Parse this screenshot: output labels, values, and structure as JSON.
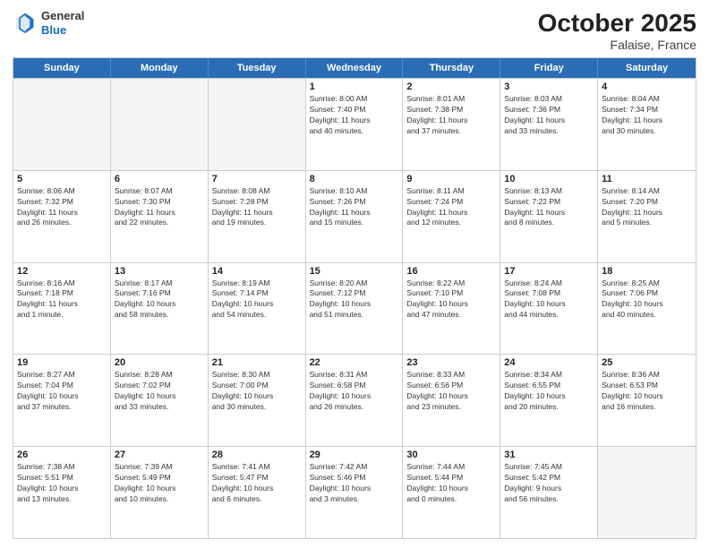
{
  "header": {
    "logo_general": "General",
    "logo_blue": "Blue",
    "month": "October 2025",
    "location": "Falaise, France"
  },
  "days_of_week": [
    "Sunday",
    "Monday",
    "Tuesday",
    "Wednesday",
    "Thursday",
    "Friday",
    "Saturday"
  ],
  "weeks": [
    [
      {
        "day": "",
        "lines": []
      },
      {
        "day": "",
        "lines": []
      },
      {
        "day": "",
        "lines": []
      },
      {
        "day": "1",
        "lines": [
          "Sunrise: 8:00 AM",
          "Sunset: 7:40 PM",
          "Daylight: 11 hours",
          "and 40 minutes."
        ]
      },
      {
        "day": "2",
        "lines": [
          "Sunrise: 8:01 AM",
          "Sunset: 7:38 PM",
          "Daylight: 11 hours",
          "and 37 minutes."
        ]
      },
      {
        "day": "3",
        "lines": [
          "Sunrise: 8:03 AM",
          "Sunset: 7:36 PM",
          "Daylight: 11 hours",
          "and 33 minutes."
        ]
      },
      {
        "day": "4",
        "lines": [
          "Sunrise: 8:04 AM",
          "Sunset: 7:34 PM",
          "Daylight: 11 hours",
          "and 30 minutes."
        ]
      }
    ],
    [
      {
        "day": "5",
        "lines": [
          "Sunrise: 8:06 AM",
          "Sunset: 7:32 PM",
          "Daylight: 11 hours",
          "and 26 minutes."
        ]
      },
      {
        "day": "6",
        "lines": [
          "Sunrise: 8:07 AM",
          "Sunset: 7:30 PM",
          "Daylight: 11 hours",
          "and 22 minutes."
        ]
      },
      {
        "day": "7",
        "lines": [
          "Sunrise: 8:08 AM",
          "Sunset: 7:28 PM",
          "Daylight: 11 hours",
          "and 19 minutes."
        ]
      },
      {
        "day": "8",
        "lines": [
          "Sunrise: 8:10 AM",
          "Sunset: 7:26 PM",
          "Daylight: 11 hours",
          "and 15 minutes."
        ]
      },
      {
        "day": "9",
        "lines": [
          "Sunrise: 8:11 AM",
          "Sunset: 7:24 PM",
          "Daylight: 11 hours",
          "and 12 minutes."
        ]
      },
      {
        "day": "10",
        "lines": [
          "Sunrise: 8:13 AM",
          "Sunset: 7:22 PM",
          "Daylight: 11 hours",
          "and 8 minutes."
        ]
      },
      {
        "day": "11",
        "lines": [
          "Sunrise: 8:14 AM",
          "Sunset: 7:20 PM",
          "Daylight: 11 hours",
          "and 5 minutes."
        ]
      }
    ],
    [
      {
        "day": "12",
        "lines": [
          "Sunrise: 8:16 AM",
          "Sunset: 7:18 PM",
          "Daylight: 11 hours",
          "and 1 minute."
        ]
      },
      {
        "day": "13",
        "lines": [
          "Sunrise: 8:17 AM",
          "Sunset: 7:16 PM",
          "Daylight: 10 hours",
          "and 58 minutes."
        ]
      },
      {
        "day": "14",
        "lines": [
          "Sunrise: 8:19 AM",
          "Sunset: 7:14 PM",
          "Daylight: 10 hours",
          "and 54 minutes."
        ]
      },
      {
        "day": "15",
        "lines": [
          "Sunrise: 8:20 AM",
          "Sunset: 7:12 PM",
          "Daylight: 10 hours",
          "and 51 minutes."
        ]
      },
      {
        "day": "16",
        "lines": [
          "Sunrise: 8:22 AM",
          "Sunset: 7:10 PM",
          "Daylight: 10 hours",
          "and 47 minutes."
        ]
      },
      {
        "day": "17",
        "lines": [
          "Sunrise: 8:24 AM",
          "Sunset: 7:08 PM",
          "Daylight: 10 hours",
          "and 44 minutes."
        ]
      },
      {
        "day": "18",
        "lines": [
          "Sunrise: 8:25 AM",
          "Sunset: 7:06 PM",
          "Daylight: 10 hours",
          "and 40 minutes."
        ]
      }
    ],
    [
      {
        "day": "19",
        "lines": [
          "Sunrise: 8:27 AM",
          "Sunset: 7:04 PM",
          "Daylight: 10 hours",
          "and 37 minutes."
        ]
      },
      {
        "day": "20",
        "lines": [
          "Sunrise: 8:28 AM",
          "Sunset: 7:02 PM",
          "Daylight: 10 hours",
          "and 33 minutes."
        ]
      },
      {
        "day": "21",
        "lines": [
          "Sunrise: 8:30 AM",
          "Sunset: 7:00 PM",
          "Daylight: 10 hours",
          "and 30 minutes."
        ]
      },
      {
        "day": "22",
        "lines": [
          "Sunrise: 8:31 AM",
          "Sunset: 6:58 PM",
          "Daylight: 10 hours",
          "and 26 minutes."
        ]
      },
      {
        "day": "23",
        "lines": [
          "Sunrise: 8:33 AM",
          "Sunset: 6:56 PM",
          "Daylight: 10 hours",
          "and 23 minutes."
        ]
      },
      {
        "day": "24",
        "lines": [
          "Sunrise: 8:34 AM",
          "Sunset: 6:55 PM",
          "Daylight: 10 hours",
          "and 20 minutes."
        ]
      },
      {
        "day": "25",
        "lines": [
          "Sunrise: 8:36 AM",
          "Sunset: 6:53 PM",
          "Daylight: 10 hours",
          "and 16 minutes."
        ]
      }
    ],
    [
      {
        "day": "26",
        "lines": [
          "Sunrise: 7:38 AM",
          "Sunset: 5:51 PM",
          "Daylight: 10 hours",
          "and 13 minutes."
        ]
      },
      {
        "day": "27",
        "lines": [
          "Sunrise: 7:39 AM",
          "Sunset: 5:49 PM",
          "Daylight: 10 hours",
          "and 10 minutes."
        ]
      },
      {
        "day": "28",
        "lines": [
          "Sunrise: 7:41 AM",
          "Sunset: 5:47 PM",
          "Daylight: 10 hours",
          "and 6 minutes."
        ]
      },
      {
        "day": "29",
        "lines": [
          "Sunrise: 7:42 AM",
          "Sunset: 5:46 PM",
          "Daylight: 10 hours",
          "and 3 minutes."
        ]
      },
      {
        "day": "30",
        "lines": [
          "Sunrise: 7:44 AM",
          "Sunset: 5:44 PM",
          "Daylight: 10 hours",
          "and 0 minutes."
        ]
      },
      {
        "day": "31",
        "lines": [
          "Sunrise: 7:45 AM",
          "Sunset: 5:42 PM",
          "Daylight: 9 hours",
          "and 56 minutes."
        ]
      },
      {
        "day": "",
        "lines": []
      }
    ]
  ]
}
